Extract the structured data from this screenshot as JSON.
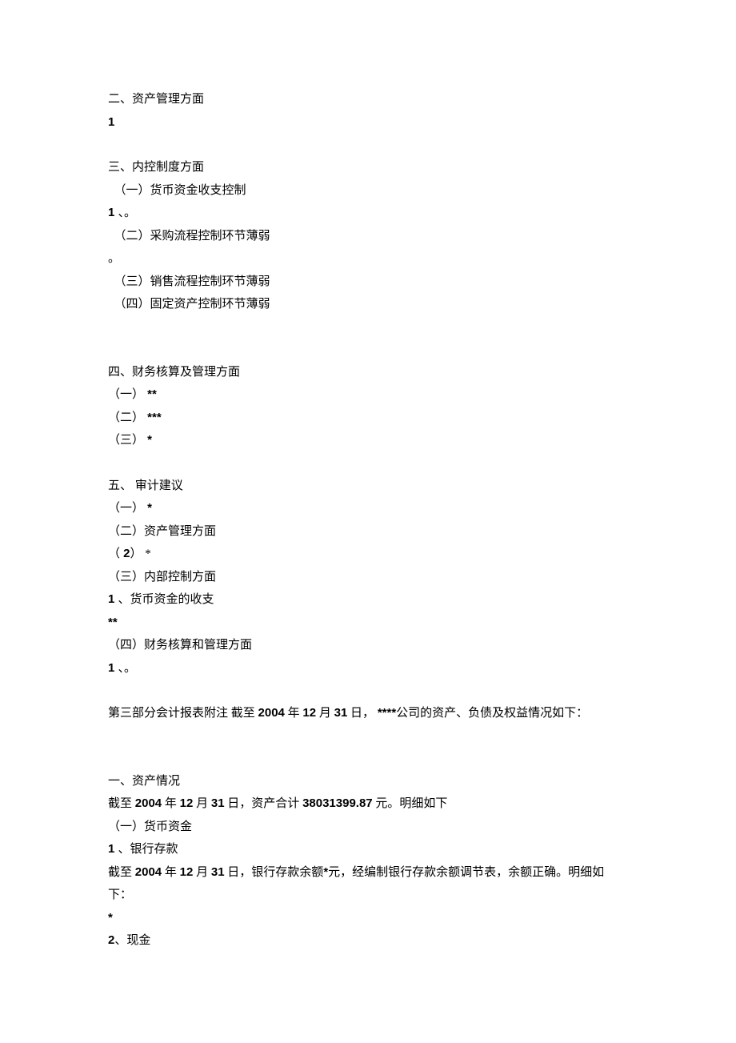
{
  "lines": [
    {
      "type": "text",
      "name": "heading-2",
      "text": "二、资产管理方面"
    },
    {
      "type": "num",
      "name": "item-2-1-number",
      "num": "1",
      "rest": ""
    },
    {
      "type": "blank"
    },
    {
      "type": "text",
      "name": "heading-3",
      "text": "三、内控制度方面"
    },
    {
      "type": "text",
      "name": "heading-3-1",
      "text": "　（一）货币资金收支控制"
    },
    {
      "type": "num",
      "name": "item-3-1-1",
      "num": "1 ",
      "rest": "、。"
    },
    {
      "type": "text",
      "name": "heading-3-2",
      "text": "　（二）采购流程控制环节薄弱"
    },
    {
      "type": "text",
      "name": "item-3-2-dot",
      "text": "。"
    },
    {
      "type": "text",
      "name": "heading-3-3",
      "text": "　（三）销售流程控制环节薄弱"
    },
    {
      "type": "text",
      "name": "heading-3-4",
      "text": "　（四）固定资产控制环节薄弱"
    },
    {
      "type": "blank"
    },
    {
      "type": "blank"
    },
    {
      "type": "text",
      "name": "heading-4",
      "text": "四、财务核算及管理方面"
    },
    {
      "type": "num",
      "name": "item-4-1",
      "num": " ** ",
      "rest": "",
      "prefix": "（一）"
    },
    {
      "type": "num",
      "name": "item-4-2",
      "num": " *** ",
      "rest": "",
      "prefix": "（二）"
    },
    {
      "type": "num",
      "name": "item-4-3",
      "num": " * ",
      "rest": "",
      "prefix": "（三）"
    },
    {
      "type": "blank"
    },
    {
      "type": "text",
      "name": "heading-5",
      "text": "五、 审计建议"
    },
    {
      "type": "num",
      "name": "item-5-1",
      "num": " * ",
      "rest": "",
      "prefix": "（一）"
    },
    {
      "type": "text",
      "name": "heading-5-2",
      "text": "（二）资产管理方面"
    },
    {
      "type": "num",
      "name": "item-5-2-2",
      "num": " 2",
      "rest": "",
      "prefix": "（",
      "suffix": "） *"
    },
    {
      "type": "text",
      "name": "heading-5-3",
      "text": "（三）内部控制方面"
    },
    {
      "type": "num",
      "name": "item-5-3-1",
      "num": "1 ",
      "rest": "、货币资金的收支"
    },
    {
      "type": "num",
      "name": "item-5-3-1-stars",
      "num": "**",
      "rest": ""
    },
    {
      "type": "text",
      "name": "heading-5-4",
      "text": "（四）财务核算和管理方面"
    },
    {
      "type": "num",
      "name": "item-5-4-1",
      "num": "1 ",
      "rest": "、。"
    },
    {
      "type": "blank"
    },
    {
      "type": "mixed",
      "name": "part3-heading",
      "segments": [
        {
          "t": "第三部分会计报表附注 截至 "
        },
        {
          "t": "2004",
          "num": true
        },
        {
          "t": " 年 "
        },
        {
          "t": "12",
          "num": true
        },
        {
          "t": " 月 "
        },
        {
          "t": "31",
          "num": true
        },
        {
          "t": " 日， "
        },
        {
          "t": "****",
          "num": true
        },
        {
          "t": "公司的资产、负债及权益情况如下："
        }
      ]
    },
    {
      "type": "blank"
    },
    {
      "type": "blank"
    },
    {
      "type": "text",
      "name": "heading-assets",
      "text": "一、资产情况"
    },
    {
      "type": "mixed",
      "name": "assets-total-line",
      "segments": [
        {
          "t": "截至 "
        },
        {
          "t": "2004",
          "num": true
        },
        {
          "t": " 年 "
        },
        {
          "t": "12",
          "num": true
        },
        {
          "t": " 月 "
        },
        {
          "t": "31",
          "num": true
        },
        {
          "t": " 日，资产合计 "
        },
        {
          "t": "38031399.87",
          "num": true
        },
        {
          "t": " 元。明细如下"
        }
      ]
    },
    {
      "type": "text",
      "name": "heading-cash",
      "text": "（一）货币资金"
    },
    {
      "type": "num",
      "name": "item-bank-deposit",
      "num": "1 ",
      "rest": "、银行存款"
    },
    {
      "type": "mixed",
      "name": "bank-deposit-line",
      "segments": [
        {
          "t": "截至 "
        },
        {
          "t": "2004",
          "num": true
        },
        {
          "t": " 年 "
        },
        {
          "t": "12",
          "num": true
        },
        {
          "t": " 月 "
        },
        {
          "t": "31",
          "num": true
        },
        {
          "t": " 日，银行存款余额"
        },
        {
          "t": "*",
          "num": true
        },
        {
          "t": "元，经编制银行存款余额调节表，余额正确。明细如下："
        }
      ]
    },
    {
      "type": "num",
      "name": "bank-deposit-star",
      "num": "*",
      "rest": ""
    },
    {
      "type": "num",
      "name": "item-cash",
      "num": "2",
      "rest": "、现金"
    }
  ]
}
